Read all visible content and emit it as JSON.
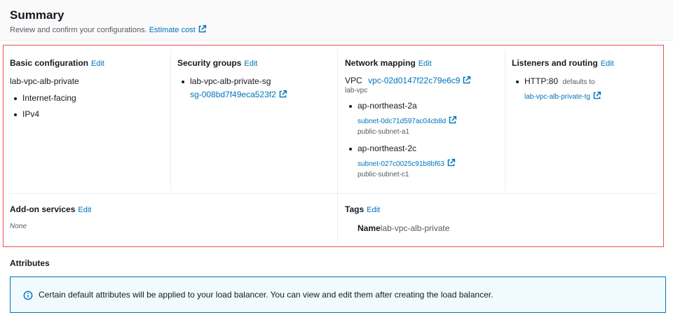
{
  "summary": {
    "title": "Summary",
    "subtitle": "Review and confirm your configurations.",
    "estimate_cost": "Estimate cost"
  },
  "basic": {
    "title": "Basic configuration",
    "edit": "Edit",
    "name": "lab-vpc-alb-private",
    "items": [
      "Internet-facing",
      "IPv4"
    ]
  },
  "security": {
    "title": "Security groups",
    "edit": "Edit",
    "group_name": "lab-vpc-alb-private-sg",
    "group_id": "sg-008bd7f49eca523f2"
  },
  "network": {
    "title": "Network mapping",
    "edit": "Edit",
    "vpc_label": "VPC",
    "vpc_id": "vpc-02d0147f22c79e6c9",
    "vpc_name": "lab-vpc",
    "zones": [
      {
        "az": "ap-northeast-2a",
        "subnet_id": "subnet-0dc71d597ac04cb8d",
        "subnet_name": "public-subnet-a1"
      },
      {
        "az": "ap-northeast-2c",
        "subnet_id": "subnet-027c0025c91b8bf63",
        "subnet_name": "public-subnet-c1"
      }
    ]
  },
  "listeners": {
    "title": "Listeners and routing",
    "edit": "Edit",
    "protocol": "HTTP:80",
    "defaults_to": "defaults to",
    "target": "lab-vpc-alb-private-tg"
  },
  "addons": {
    "title": "Add-on services",
    "edit": "Edit",
    "value": "None"
  },
  "tags": {
    "title": "Tags",
    "edit": "Edit",
    "key": "Name",
    "value": "lab-vpc-alb-private"
  },
  "attributes": {
    "title": "Attributes",
    "info": "Certain default attributes will be applied to your load balancer. You can view and edit them after creating the load balancer."
  },
  "colors": {
    "link": "#0073bb",
    "highlight_border": "#e8505b",
    "info_bg": "#f1faff"
  }
}
